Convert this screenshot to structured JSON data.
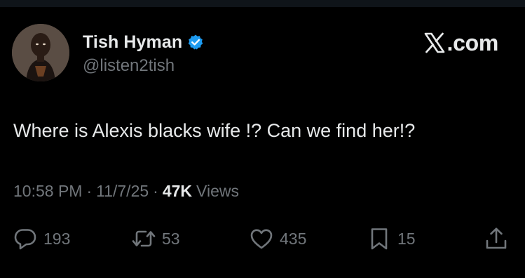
{
  "post": {
    "author": {
      "display_name": "Tish Hyman",
      "handle": "@listen2tish",
      "verified": true,
      "verified_color": "#1d9bf0",
      "avatar_icon": "profile-photo"
    },
    "brand": {
      "icon": "x-logo-icon",
      "suffix": ".com"
    },
    "text": "Where is Alexis blacks wife !? Can we find her!?",
    "meta": {
      "time": "10:58 PM",
      "separator": "·",
      "date": "11/7/25",
      "views_count": "47K",
      "views_label": "Views"
    },
    "actions": {
      "replies": "193",
      "reposts": "53",
      "likes": "435",
      "bookmarks": "15"
    }
  },
  "colors": {
    "background": "#000000",
    "primary_text": "#e7e9ea",
    "secondary_text": "#71767b"
  }
}
